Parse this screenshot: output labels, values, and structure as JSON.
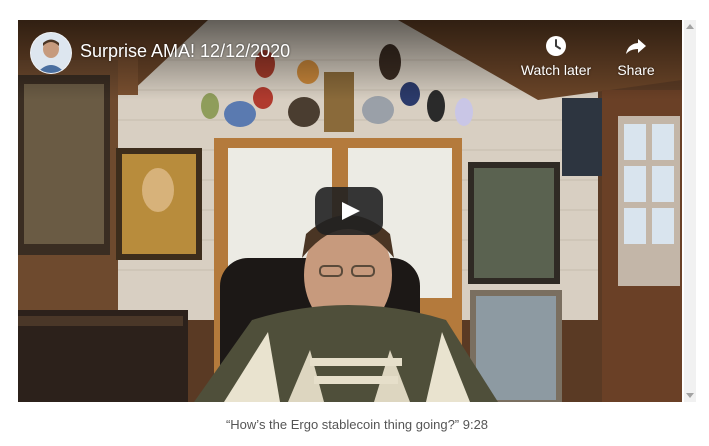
{
  "video": {
    "title": "Surprise AMA! 12/12/2020",
    "watch_later_label": "Watch later",
    "share_label": "Share",
    "icons": {
      "watch_later": "clock-icon",
      "share": "share-arrow-icon",
      "play": "play-icon",
      "avatar": "channel-avatar"
    },
    "play_button_color": "#212121"
  },
  "caption": "“How’s the Ergo stablecoin thing going?” 9:28"
}
